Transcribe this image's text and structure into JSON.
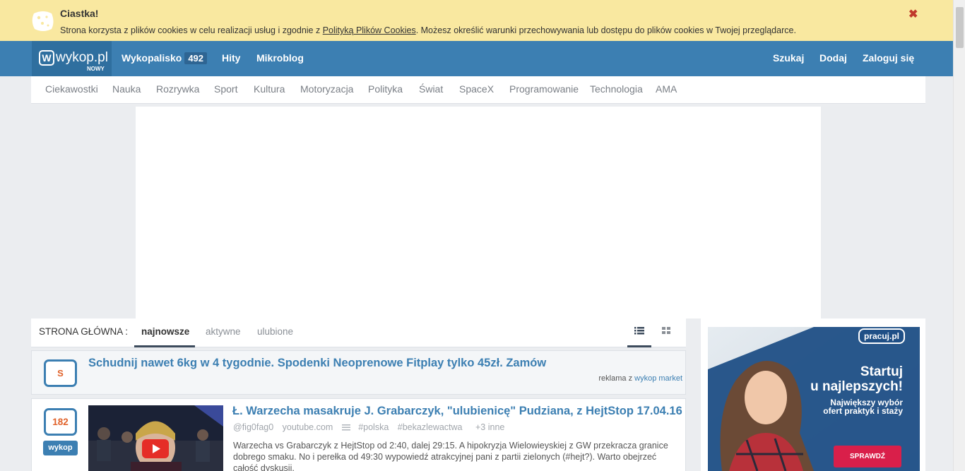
{
  "cookie": {
    "title": "Ciastka!",
    "text_before": "Strona korzysta z plików cookies w celu realizacji usług i zgodnie z ",
    "policy_link": "Polityką Plików Cookies",
    "text_after": ". Możesz określić warunki przechowywania lub dostępu do plików cookies w Twojej przeglądarce.",
    "close_glyph": "✖"
  },
  "header": {
    "logo_text": "wykop.pl",
    "logo_mark": "W",
    "logo_sub": "NOWY",
    "nav": {
      "wykopalisko": "Wykopalisko",
      "wykopalisko_count": "492",
      "hity": "Hity",
      "mikroblog": "Mikroblog",
      "szukaj": "Szukaj",
      "dodaj": "Dodaj",
      "zaloguj": "Zaloguj się"
    }
  },
  "categories": [
    "Ciekawostki",
    "Nauka",
    "Rozrywka",
    "Sport",
    "Kultura",
    "Motoryzacja",
    "Polityka",
    "Świat",
    "SpaceX",
    "Programowanie",
    "Technologia",
    "AMA"
  ],
  "main": {
    "section_label": "STRONA GŁÓWNA :",
    "tabs": [
      "najnowsze",
      "aktywne",
      "ulubione"
    ],
    "view_icons": [
      "list-view-icon",
      "grid-view-icon"
    ]
  },
  "sponsored": {
    "badge": "S",
    "title": "Schudnij nawet 6kg w 4 tygodnie. Spodenki Neoprenowe Fitplay tylko 45zł. Zamów",
    "ad_prefix": "reklama z ",
    "ad_link": "wykop market"
  },
  "entry": {
    "votes": "182",
    "vote_button": "wykop",
    "title": "Ł. Warzecha masakruje J. Grabarczyk, \"ulubienicę\" Pudziana, z HejtStop 17.04.16",
    "author": "@fig0fag0",
    "source": "youtube.com",
    "tags": [
      "#polska",
      "#bekazlewactwa"
    ],
    "more_tags": "+3 inne",
    "description": "Warzecha vs Grabarczyk z HejtStop od 2:40, dalej 29:15. A hipokryzja Wielowieyskiej z GW przekracza granice dobrego smaku. No i perełka od 49:30 wypowiedź atrakcyjnej pani z partii zielonych (#hejt?). Warto obejrzeć całość dyskusji."
  },
  "sidebar_ad": {
    "brand": "pracuj.pl",
    "headline_1": "Startuj",
    "headline_2": "u najlepszych!",
    "sub_1": "Największy wybór",
    "sub_2": "ofert praktyk i staży",
    "cta": "SPRAWDŹ"
  },
  "colors": {
    "brand_blue": "#3c7fb2",
    "cookie_bg": "#f9e8a0",
    "vote_orange": "#e0622a",
    "cta_red": "#d91f4a"
  }
}
